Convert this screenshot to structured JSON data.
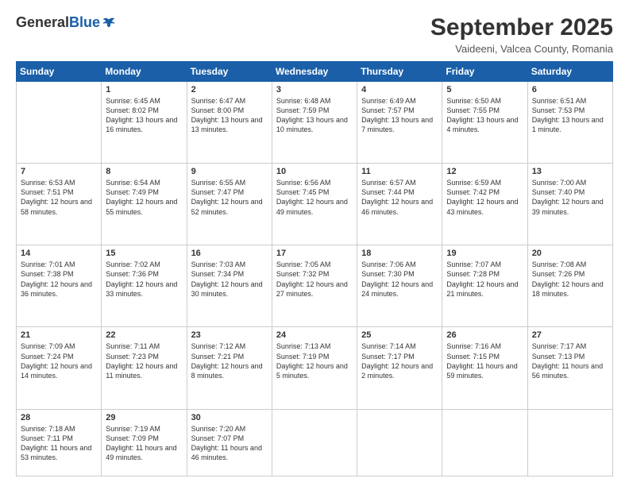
{
  "header": {
    "logo_general": "General",
    "logo_blue": "Blue",
    "title": "September 2025",
    "location": "Vaideeni, Valcea County, Romania"
  },
  "weekdays": [
    "Sunday",
    "Monday",
    "Tuesday",
    "Wednesday",
    "Thursday",
    "Friday",
    "Saturday"
  ],
  "weeks": [
    [
      {
        "day": "",
        "sunrise": "",
        "sunset": "",
        "daylight": ""
      },
      {
        "day": "1",
        "sunrise": "Sunrise: 6:45 AM",
        "sunset": "Sunset: 8:02 PM",
        "daylight": "Daylight: 13 hours and 16 minutes."
      },
      {
        "day": "2",
        "sunrise": "Sunrise: 6:47 AM",
        "sunset": "Sunset: 8:00 PM",
        "daylight": "Daylight: 13 hours and 13 minutes."
      },
      {
        "day": "3",
        "sunrise": "Sunrise: 6:48 AM",
        "sunset": "Sunset: 7:59 PM",
        "daylight": "Daylight: 13 hours and 10 minutes."
      },
      {
        "day": "4",
        "sunrise": "Sunrise: 6:49 AM",
        "sunset": "Sunset: 7:57 PM",
        "daylight": "Daylight: 13 hours and 7 minutes."
      },
      {
        "day": "5",
        "sunrise": "Sunrise: 6:50 AM",
        "sunset": "Sunset: 7:55 PM",
        "daylight": "Daylight: 13 hours and 4 minutes."
      },
      {
        "day": "6",
        "sunrise": "Sunrise: 6:51 AM",
        "sunset": "Sunset: 7:53 PM",
        "daylight": "Daylight: 13 hours and 1 minute."
      }
    ],
    [
      {
        "day": "7",
        "sunrise": "Sunrise: 6:53 AM",
        "sunset": "Sunset: 7:51 PM",
        "daylight": "Daylight: 12 hours and 58 minutes."
      },
      {
        "day": "8",
        "sunrise": "Sunrise: 6:54 AM",
        "sunset": "Sunset: 7:49 PM",
        "daylight": "Daylight: 12 hours and 55 minutes."
      },
      {
        "day": "9",
        "sunrise": "Sunrise: 6:55 AM",
        "sunset": "Sunset: 7:47 PM",
        "daylight": "Daylight: 12 hours and 52 minutes."
      },
      {
        "day": "10",
        "sunrise": "Sunrise: 6:56 AM",
        "sunset": "Sunset: 7:45 PM",
        "daylight": "Daylight: 12 hours and 49 minutes."
      },
      {
        "day": "11",
        "sunrise": "Sunrise: 6:57 AM",
        "sunset": "Sunset: 7:44 PM",
        "daylight": "Daylight: 12 hours and 46 minutes."
      },
      {
        "day": "12",
        "sunrise": "Sunrise: 6:59 AM",
        "sunset": "Sunset: 7:42 PM",
        "daylight": "Daylight: 12 hours and 43 minutes."
      },
      {
        "day": "13",
        "sunrise": "Sunrise: 7:00 AM",
        "sunset": "Sunset: 7:40 PM",
        "daylight": "Daylight: 12 hours and 39 minutes."
      }
    ],
    [
      {
        "day": "14",
        "sunrise": "Sunrise: 7:01 AM",
        "sunset": "Sunset: 7:38 PM",
        "daylight": "Daylight: 12 hours and 36 minutes."
      },
      {
        "day": "15",
        "sunrise": "Sunrise: 7:02 AM",
        "sunset": "Sunset: 7:36 PM",
        "daylight": "Daylight: 12 hours and 33 minutes."
      },
      {
        "day": "16",
        "sunrise": "Sunrise: 7:03 AM",
        "sunset": "Sunset: 7:34 PM",
        "daylight": "Daylight: 12 hours and 30 minutes."
      },
      {
        "day": "17",
        "sunrise": "Sunrise: 7:05 AM",
        "sunset": "Sunset: 7:32 PM",
        "daylight": "Daylight: 12 hours and 27 minutes."
      },
      {
        "day": "18",
        "sunrise": "Sunrise: 7:06 AM",
        "sunset": "Sunset: 7:30 PM",
        "daylight": "Daylight: 12 hours and 24 minutes."
      },
      {
        "day": "19",
        "sunrise": "Sunrise: 7:07 AM",
        "sunset": "Sunset: 7:28 PM",
        "daylight": "Daylight: 12 hours and 21 minutes."
      },
      {
        "day": "20",
        "sunrise": "Sunrise: 7:08 AM",
        "sunset": "Sunset: 7:26 PM",
        "daylight": "Daylight: 12 hours and 18 minutes."
      }
    ],
    [
      {
        "day": "21",
        "sunrise": "Sunrise: 7:09 AM",
        "sunset": "Sunset: 7:24 PM",
        "daylight": "Daylight: 12 hours and 14 minutes."
      },
      {
        "day": "22",
        "sunrise": "Sunrise: 7:11 AM",
        "sunset": "Sunset: 7:23 PM",
        "daylight": "Daylight: 12 hours and 11 minutes."
      },
      {
        "day": "23",
        "sunrise": "Sunrise: 7:12 AM",
        "sunset": "Sunset: 7:21 PM",
        "daylight": "Daylight: 12 hours and 8 minutes."
      },
      {
        "day": "24",
        "sunrise": "Sunrise: 7:13 AM",
        "sunset": "Sunset: 7:19 PM",
        "daylight": "Daylight: 12 hours and 5 minutes."
      },
      {
        "day": "25",
        "sunrise": "Sunrise: 7:14 AM",
        "sunset": "Sunset: 7:17 PM",
        "daylight": "Daylight: 12 hours and 2 minutes."
      },
      {
        "day": "26",
        "sunrise": "Sunrise: 7:16 AM",
        "sunset": "Sunset: 7:15 PM",
        "daylight": "Daylight: 11 hours and 59 minutes."
      },
      {
        "day": "27",
        "sunrise": "Sunrise: 7:17 AM",
        "sunset": "Sunset: 7:13 PM",
        "daylight": "Daylight: 11 hours and 56 minutes."
      }
    ],
    [
      {
        "day": "28",
        "sunrise": "Sunrise: 7:18 AM",
        "sunset": "Sunset: 7:11 PM",
        "daylight": "Daylight: 11 hours and 53 minutes."
      },
      {
        "day": "29",
        "sunrise": "Sunrise: 7:19 AM",
        "sunset": "Sunset: 7:09 PM",
        "daylight": "Daylight: 11 hours and 49 minutes."
      },
      {
        "day": "30",
        "sunrise": "Sunrise: 7:20 AM",
        "sunset": "Sunset: 7:07 PM",
        "daylight": "Daylight: 11 hours and 46 minutes."
      },
      {
        "day": "",
        "sunrise": "",
        "sunset": "",
        "daylight": ""
      },
      {
        "day": "",
        "sunrise": "",
        "sunset": "",
        "daylight": ""
      },
      {
        "day": "",
        "sunrise": "",
        "sunset": "",
        "daylight": ""
      },
      {
        "day": "",
        "sunrise": "",
        "sunset": "",
        "daylight": ""
      }
    ]
  ]
}
